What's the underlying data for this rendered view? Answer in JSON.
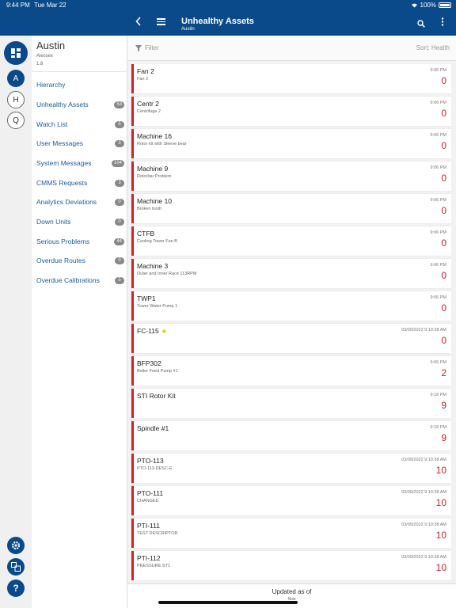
{
  "status": {
    "time": "9:44 PM",
    "date": "Tue Mar 22",
    "battery": "100%"
  },
  "site": {
    "name": "Austin",
    "user": "Alessex",
    "version": "1.8"
  },
  "rail": {
    "a_label": "A",
    "h_label": "H",
    "q_label": "Q",
    "help_label": "?"
  },
  "nav": [
    {
      "label": "Hierarchy",
      "badge": ""
    },
    {
      "label": "Unhealthy Assets",
      "badge": "53"
    },
    {
      "label": "Watch List",
      "badge": "5"
    },
    {
      "label": "User Messages",
      "badge": "3"
    },
    {
      "label": "System Messages",
      "badge": "104"
    },
    {
      "label": "CMMS Requests",
      "badge": "3"
    },
    {
      "label": "Analytics Deviations",
      "badge": "0"
    },
    {
      "label": "Down Units",
      "badge": "0"
    },
    {
      "label": "Serious Problems",
      "badge": "44"
    },
    {
      "label": "Overdue Routes",
      "badge": "0"
    },
    {
      "label": "Overdue Calibrations",
      "badge": "5"
    }
  ],
  "header": {
    "title": "Unhealthy Assets",
    "subtitle": "Austin"
  },
  "filter": {
    "placeholder": "Filter",
    "sort": "Sort: Health"
  },
  "assets": [
    {
      "name": "Fan 2",
      "desc": "Fan 2",
      "time": "9:06 PM",
      "count": "0",
      "star": false
    },
    {
      "name": "Centr 2",
      "desc": "Centrifuge 2",
      "time": "9:06 PM",
      "count": "0",
      "star": false
    },
    {
      "name": "Machine 16",
      "desc": "Rotor kit with Sleeve bear",
      "time": "9:06 PM",
      "count": "0",
      "star": false
    },
    {
      "name": "Machine 9",
      "desc": "Rotorbar Problem",
      "time": "9:06 PM",
      "count": "0",
      "star": false
    },
    {
      "name": "Machine 10",
      "desc": "Broken tooth",
      "time": "9:06 PM",
      "count": "0",
      "star": false
    },
    {
      "name": "CTFB",
      "desc": "Cooling Tower Fan B",
      "time": "9:06 PM",
      "count": "0",
      "star": false
    },
    {
      "name": "Machine 3",
      "desc": "Outer and Inner Race 113RPM",
      "time": "9:06 PM",
      "count": "0",
      "star": false
    },
    {
      "name": "TWP1",
      "desc": "Tower Water Pump 1",
      "time": "9:06 PM",
      "count": "0",
      "star": false
    },
    {
      "name": "FC-115",
      "desc": "",
      "time": "03/09/2022 9:10:38 AM",
      "count": "0",
      "star": true
    },
    {
      "name": "BFP302",
      "desc": "Boiler Feed Pump #1",
      "time": "9:06 PM",
      "count": "2",
      "star": false
    },
    {
      "name": "STI Rotor Kit",
      "desc": "",
      "time": "9:18 PM",
      "count": "9",
      "star": false
    },
    {
      "name": "Spindle #1",
      "desc": "",
      "time": "9:18 PM",
      "count": "9",
      "star": false
    },
    {
      "name": "PTO-113",
      "desc": "PTO-113-DESC-E",
      "time": "03/09/2022 9:10:38 AM",
      "count": "10",
      "star": false
    },
    {
      "name": "PTO-111",
      "desc": "CHANGED",
      "time": "03/09/2022 9:10:38 AM",
      "count": "10",
      "star": false
    },
    {
      "name": "PTI-111",
      "desc": "TEST DESCRIPTOR",
      "time": "03/09/2022 9:10:38 AM",
      "count": "10",
      "star": false
    },
    {
      "name": "PTI-112",
      "desc": "PRESSURE ST1",
      "time": "03/09/2022 9:10:38 AM",
      "count": "10",
      "star": false
    }
  ],
  "footer": {
    "updated": "Updated as of",
    "when": "Now"
  },
  "colors": {
    "primary": "#0b4a8a",
    "alert": "#d0202a",
    "star": "#e6b800"
  }
}
